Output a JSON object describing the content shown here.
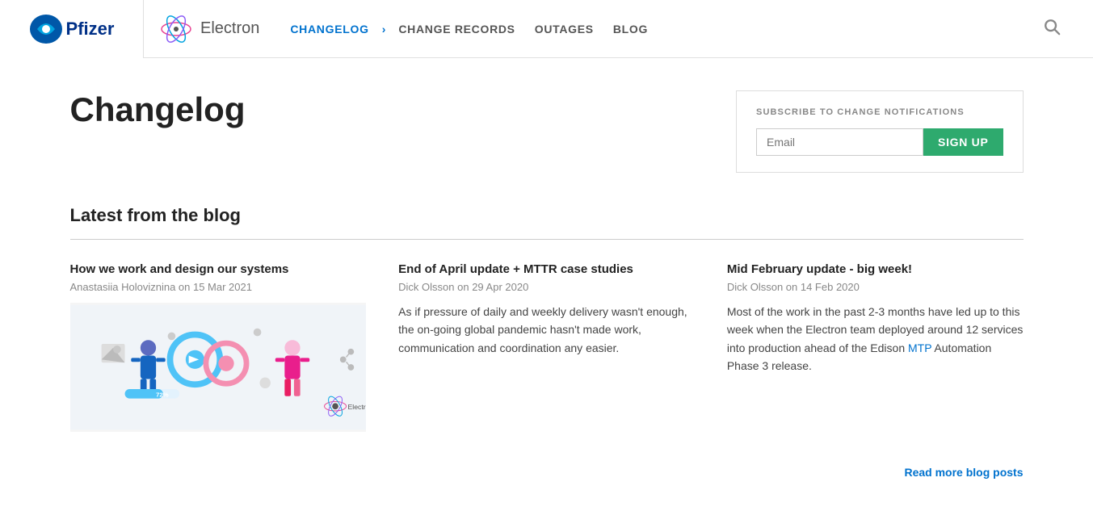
{
  "header": {
    "pfizer_name": "Pfizer",
    "electron_name": "Electron",
    "nav": {
      "changelog_label": "CHANGELOG",
      "change_records_label": "CHANGE RECORDS",
      "outages_label": "OUTAGES",
      "blog_label": "BLOG",
      "chevron": "›"
    }
  },
  "page": {
    "title": "Changelog",
    "subscribe": {
      "label": "SUBSCRIBE TO CHANGE NOTIFICATIONS",
      "email_placeholder": "Email",
      "button_label": "SIGN UP"
    }
  },
  "blog_section": {
    "title": "Latest from the blog",
    "read_more": "Read more blog posts",
    "posts": [
      {
        "title": "How we work and design our systems",
        "author": "Anastasiia Holoviznina",
        "date": "15 Mar 2021",
        "meta": "Anastasiia Holoviznina on 15 Mar 2021",
        "has_image": true
      },
      {
        "title": "End of April update + MTTR case studies",
        "author": "Dick Olsson",
        "date": "29 Apr 2020",
        "meta": "Dick Olsson on 29 Apr 2020",
        "excerpt": "As if pressure of daily and weekly delivery wasn't enough, the on-going global pandemic hasn't made work, communication and coordination any easier.",
        "has_image": false
      },
      {
        "title": "Mid February update - big week!",
        "author": "Dick Olsson",
        "date": "14 Feb 2020",
        "meta": "Dick Olsson on 14 Feb 2020",
        "excerpt_parts": [
          "Most of the work in the past 2-3 months have led up to this week when the Electron team deployed around 12 services into production ahead of the Edison ",
          "MTP",
          " Automation Phase 3 release."
        ],
        "link_text": "MTP",
        "has_image": false
      }
    ]
  }
}
